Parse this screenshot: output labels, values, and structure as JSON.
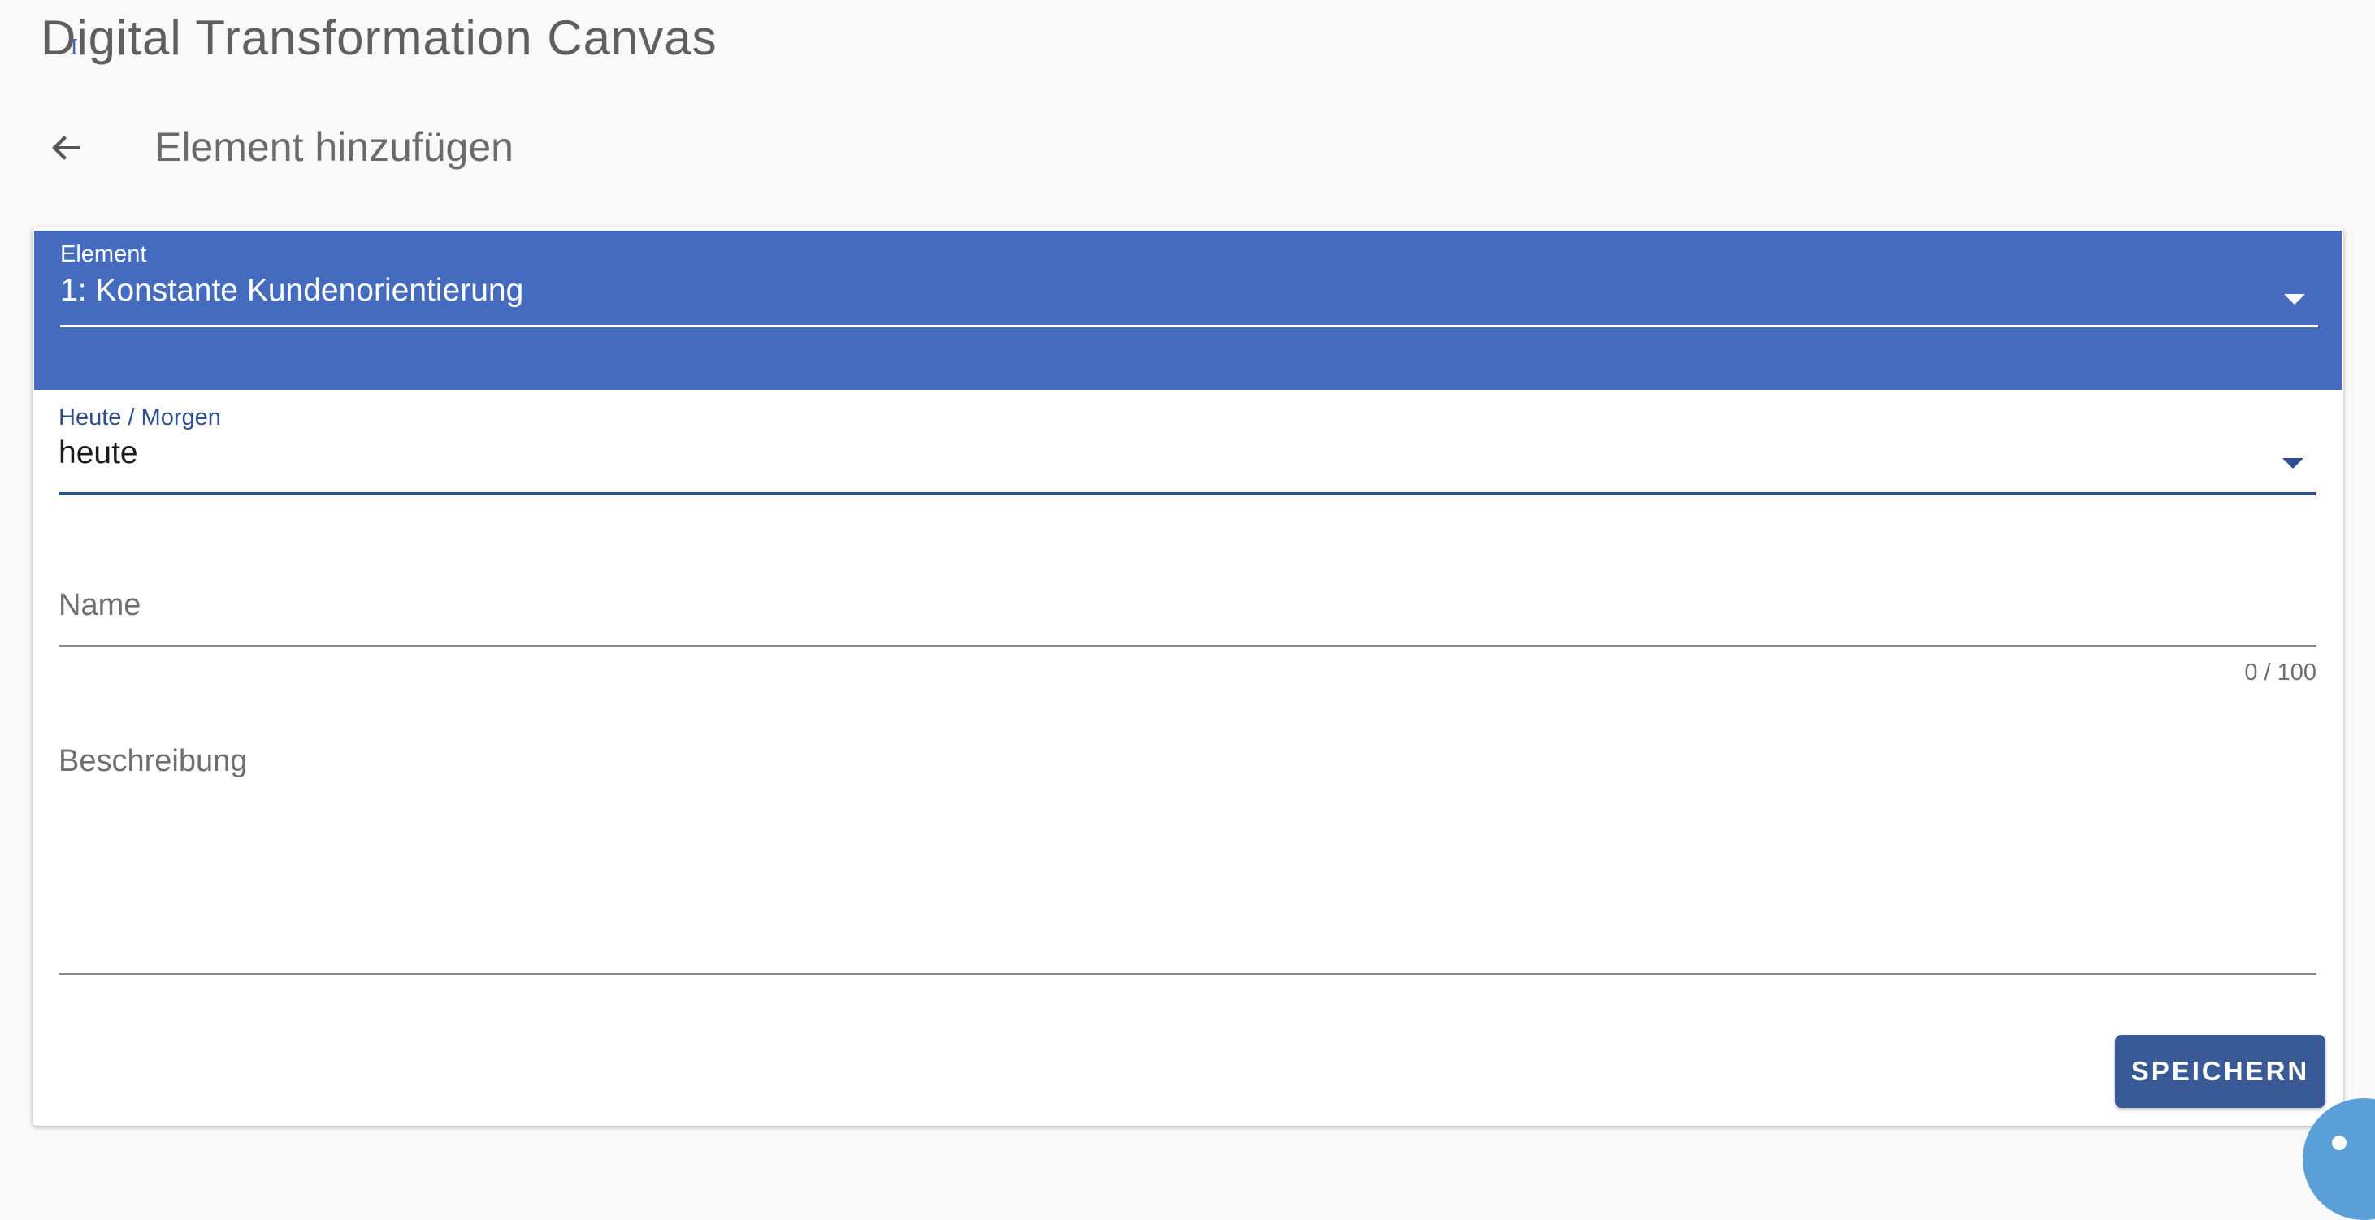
{
  "app": {
    "title": "Digital Transformation Canvas",
    "cursor_glyph": "I"
  },
  "header": {
    "back_icon": "arrow-left-icon",
    "title": "Element hinzufügen"
  },
  "form": {
    "element_field": {
      "label": "Element",
      "value": "1: Konstante Kundenorientierung"
    },
    "timeframe_field": {
      "label": "Heute / Morgen",
      "value": "heute"
    },
    "name_field": {
      "placeholder": "Name",
      "value": "",
      "counter": "0 / 100"
    },
    "description_field": {
      "placeholder": "Beschreibung",
      "value": ""
    },
    "save_label": "SPEICHERN"
  },
  "colors": {
    "header_blue": "#456bbe",
    "button_blue": "#3a5a97",
    "focus_blue": "#2f4f90",
    "fab_blue": "#5b9fd9",
    "background": "#f9f9f9"
  },
  "fab": {
    "icon": "info-icon"
  }
}
